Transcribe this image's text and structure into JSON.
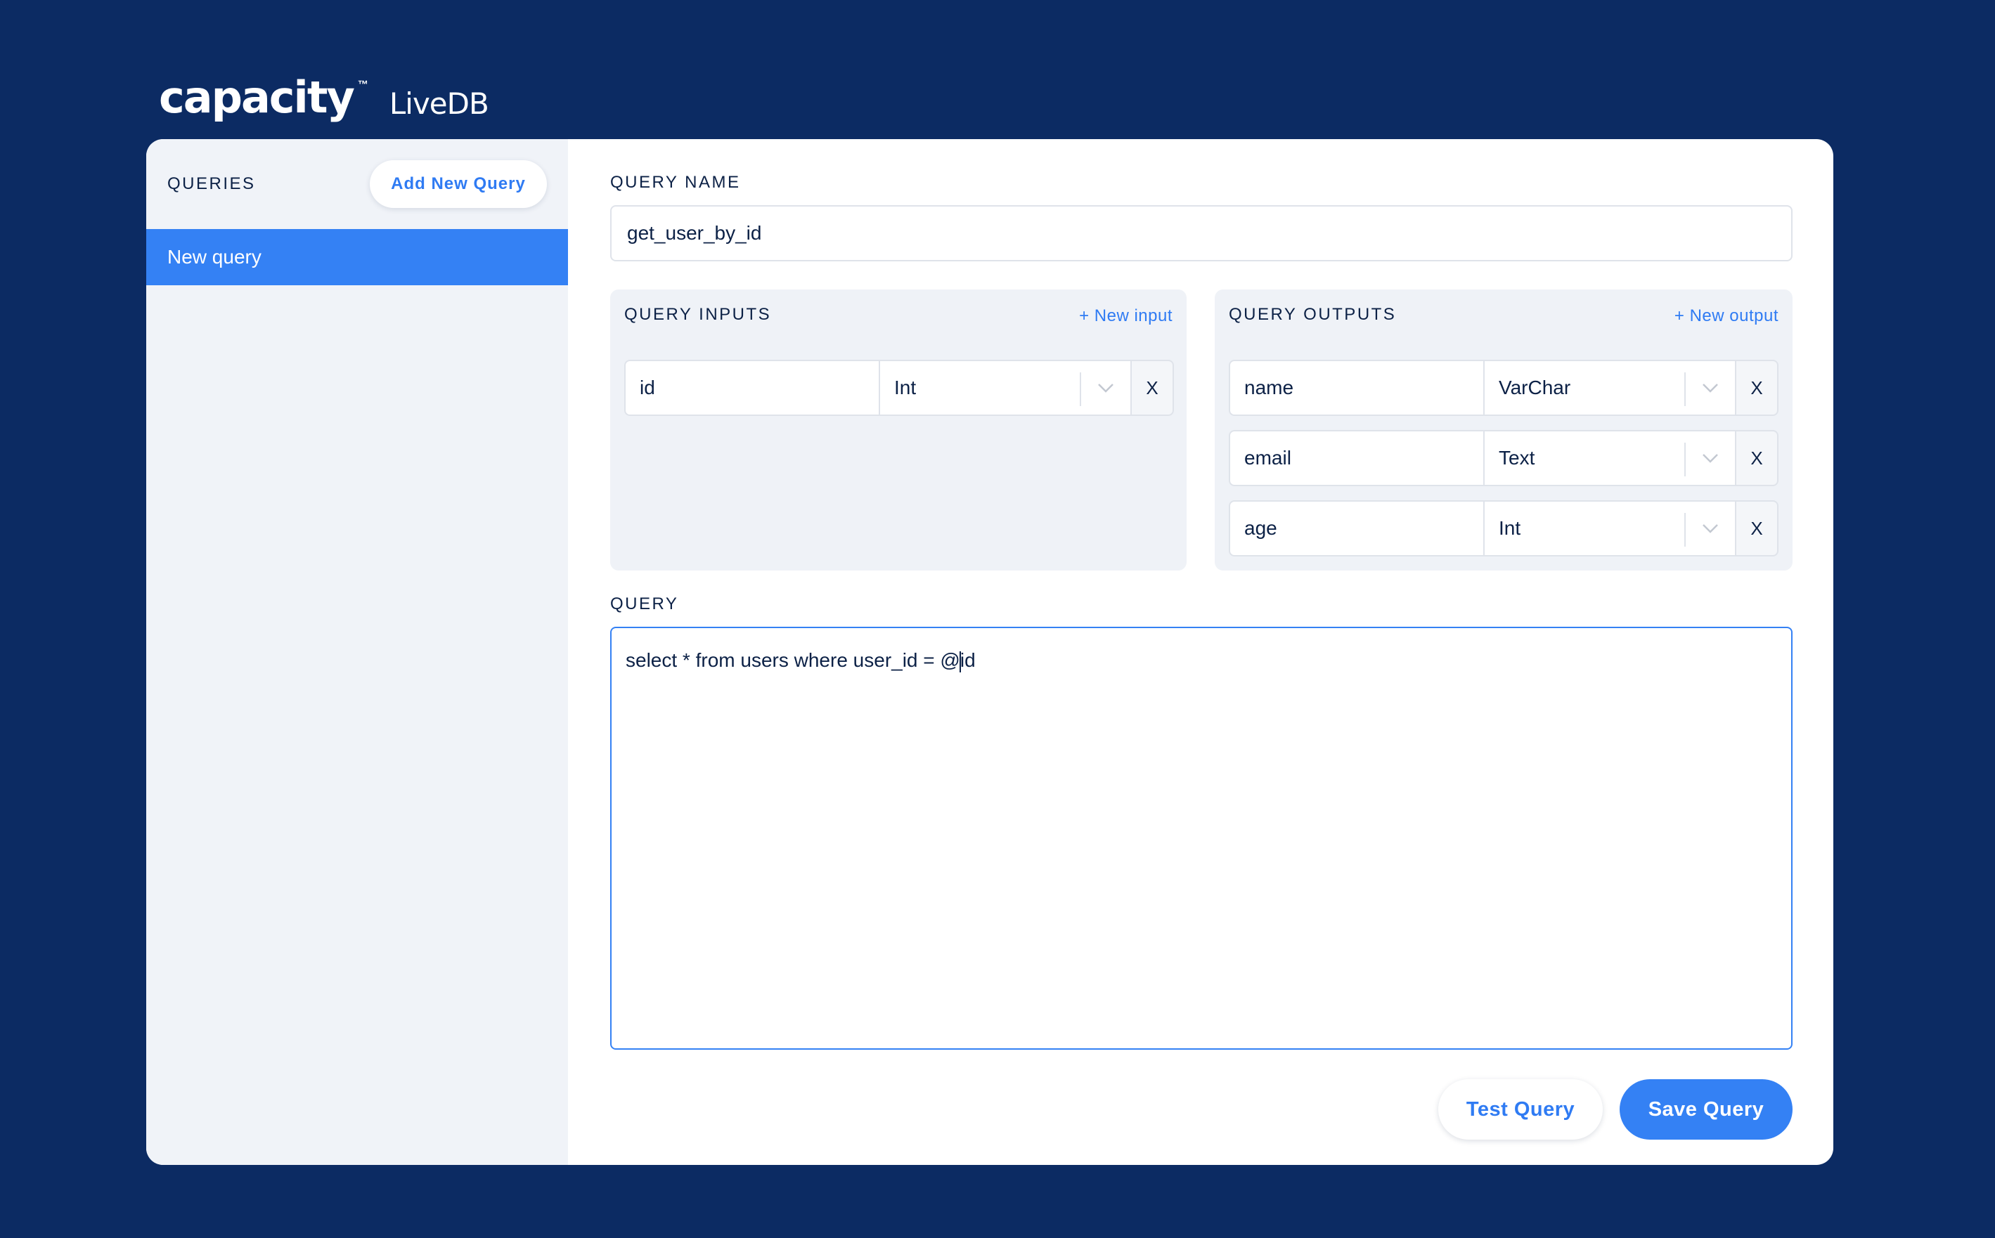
{
  "brand": {
    "name": "capacity",
    "trademark": "™",
    "product": "LiveDB"
  },
  "sidebar": {
    "title": "QUERIES",
    "add_button": "Add New Query",
    "items": [
      {
        "label": "New query",
        "selected": true
      }
    ]
  },
  "main": {
    "query_name_label": "QUERY NAME",
    "query_name_value": "get_user_by_id",
    "inputs": {
      "label": "QUERY INPUTS",
      "add_link": "+ New input",
      "rows": [
        {
          "name": "id",
          "type": "Int",
          "remove": "X"
        }
      ]
    },
    "outputs": {
      "label": "QUERY OUTPUTS",
      "add_link": "+ New output",
      "rows": [
        {
          "name": "name",
          "type": "VarChar",
          "remove": "X"
        },
        {
          "name": "email",
          "type": "Text",
          "remove": "X"
        },
        {
          "name": "age",
          "type": "Int",
          "remove": "X"
        }
      ]
    },
    "query_label": "QUERY",
    "query_text_before_caret": "select * from users where user_id = @",
    "query_text_after_caret": "id",
    "test_button": "Test Query",
    "save_button": "Save Query"
  },
  "colors": {
    "background": "#0c2b63",
    "accent": "#3481f4",
    "text": "#0c2146",
    "panel": "#eff2f7"
  },
  "icons": {
    "type_dropdown": "chevron-down-icon"
  }
}
